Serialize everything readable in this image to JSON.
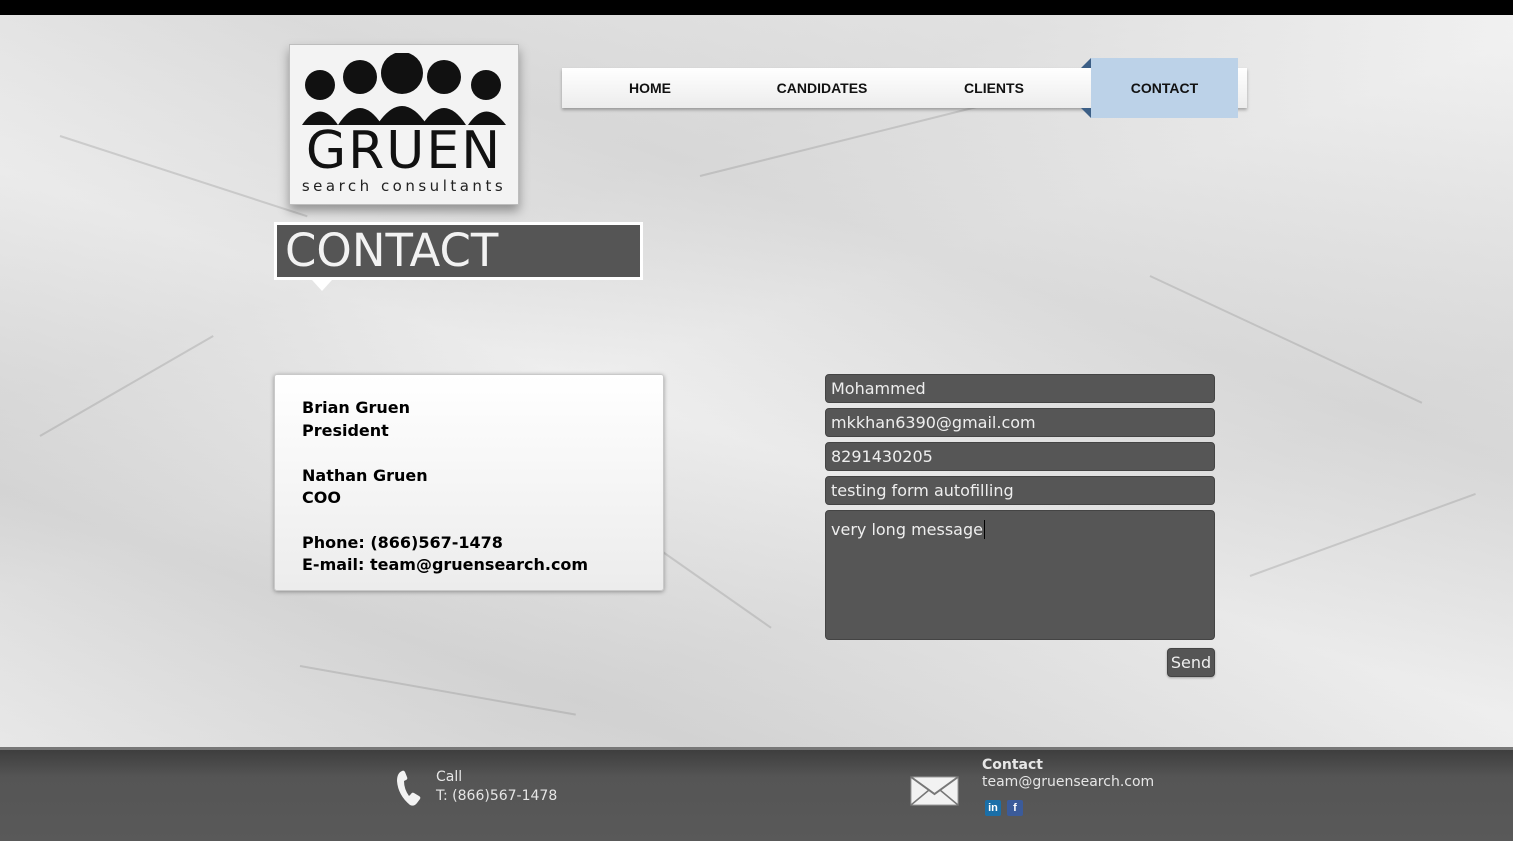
{
  "brand": {
    "name": "GRUEN",
    "tagline": "search consultants"
  },
  "nav": {
    "items": [
      {
        "label": "HOME"
      },
      {
        "label": "CANDIDATES"
      },
      {
        "label": "CLIENTS"
      },
      {
        "label": "CONTACT",
        "active": true
      }
    ]
  },
  "page": {
    "title": "CONTACT"
  },
  "info": {
    "person1_name": "Brian Gruen",
    "person1_role": "President",
    "person2_name": "Nathan Gruen",
    "person2_role": "COO",
    "phone": "Phone: (866)567-1478",
    "email": "E-mail: team@gruensearch.com"
  },
  "form": {
    "name_value": "Mohammed",
    "email_value": "mkkhan6390@gmail.com",
    "phone_value": "8291430205",
    "subject_value": "testing form autofilling",
    "message_value": "very long message",
    "send_label": "Send"
  },
  "footer": {
    "call_label": "Call",
    "call_phone": "T: (866)567-1478",
    "contact_label": "Contact",
    "contact_email": "team@gruensearch.com",
    "icons": [
      "phone-icon",
      "mail-icon",
      "linkedin-icon",
      "facebook-icon"
    ]
  },
  "colors": {
    "nav_active_bg": "#bcd2e8",
    "nav_fold": "#3c5f86",
    "field_bg": "#565656",
    "footer_bg": "#555555"
  }
}
